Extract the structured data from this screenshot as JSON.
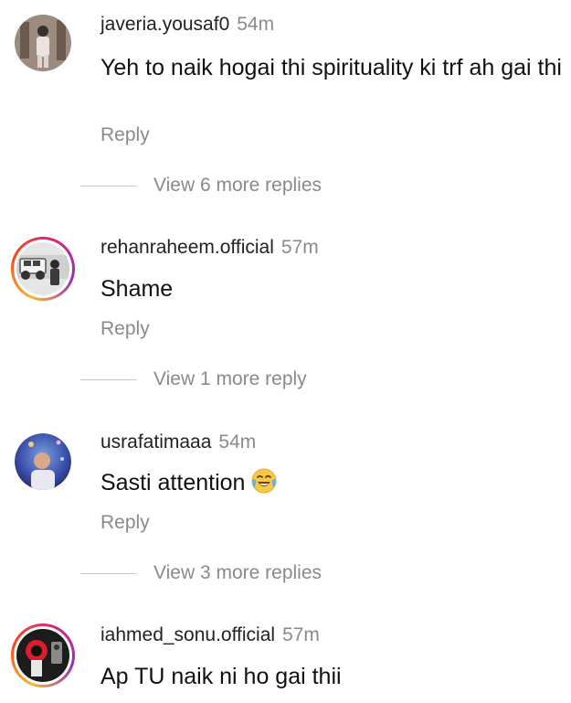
{
  "comments": [
    {
      "username": "javeria.yousaf0",
      "time": "54m",
      "text": "Yeh to naik hogai thi spirituality ki trf ah gai thi",
      "reply_label": "Reply",
      "more_replies": "View 6 more replies",
      "avatar_icon": "profile-photo"
    },
    {
      "username": "rehanraheem.official",
      "time": "57m",
      "text": "Shame",
      "reply_label": "Reply",
      "more_replies": "View 1 more reply",
      "avatar_icon": "profile-photo-story-ring"
    },
    {
      "username": "usrafatimaaa",
      "time": "54m",
      "text": "Sasti attention",
      "emoji": "face-with-tears-of-joy",
      "reply_label": "Reply",
      "more_replies": "View 3 more replies",
      "avatar_icon": "profile-photo"
    },
    {
      "username": "iahmed_sonu.official",
      "time": "57m",
      "text": "Ap TU naik ni ho gai thii",
      "avatar_icon": "profile-photo-story-ring"
    }
  ]
}
